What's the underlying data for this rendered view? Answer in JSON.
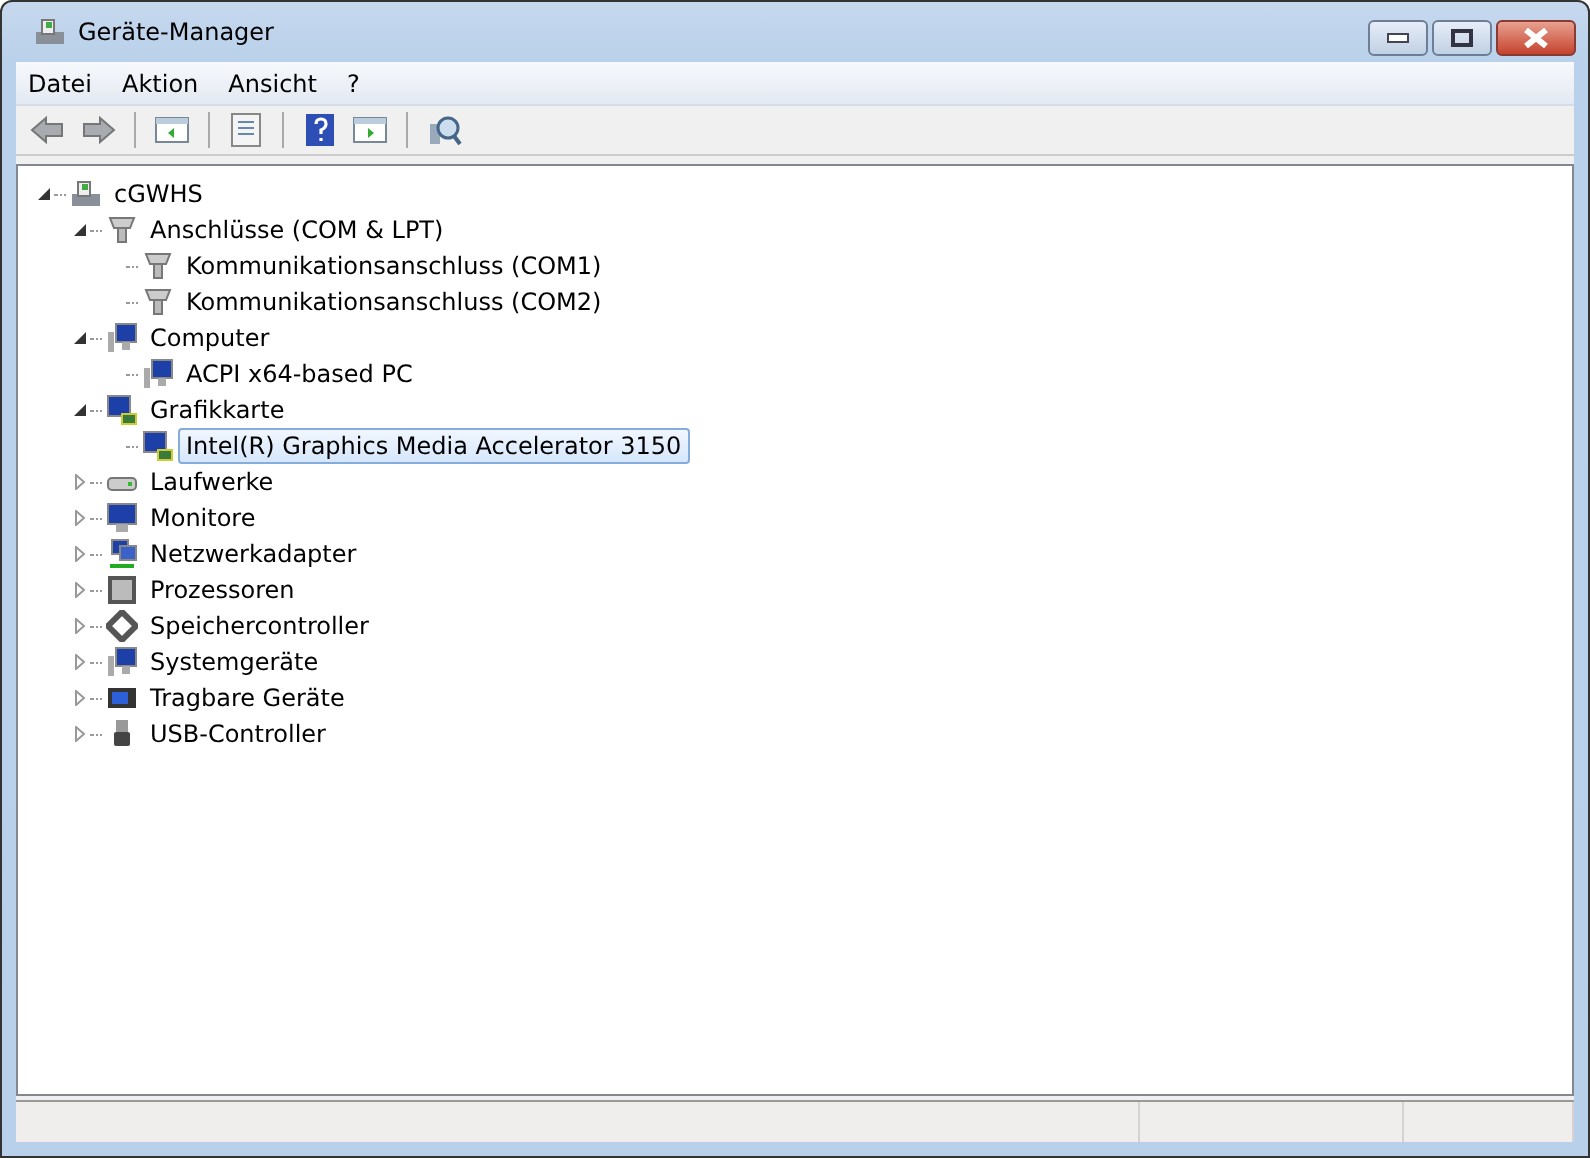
{
  "window": {
    "title": "Geräte-Manager"
  },
  "menu": [
    "Datei",
    "Aktion",
    "Ansicht",
    "?"
  ],
  "toolbar": [
    {
      "kind": "back",
      "disabled": true
    },
    {
      "kind": "forward",
      "disabled": true
    },
    {
      "kind": "sep"
    },
    {
      "kind": "pane"
    },
    {
      "kind": "sep"
    },
    {
      "kind": "props"
    },
    {
      "kind": "sep"
    },
    {
      "kind": "help"
    },
    {
      "kind": "pane2"
    },
    {
      "kind": "sep"
    },
    {
      "kind": "scan"
    }
  ],
  "tree": [
    {
      "label": "cGWHS",
      "kind": "pc",
      "expanded": true,
      "selected": false,
      "children": [
        {
          "label": "Anschlüsse (COM & LPT)",
          "kind": "port",
          "expanded": true,
          "selected": false,
          "children": [
            {
              "label": "Kommunikationsanschluss (COM1)",
              "kind": "port",
              "selected": false
            },
            {
              "label": "Kommunikationsanschluss (COM2)",
              "kind": "port",
              "selected": false
            }
          ]
        },
        {
          "label": "Computer",
          "kind": "computer",
          "expanded": true,
          "selected": false,
          "children": [
            {
              "label": "ACPI x64-based PC",
              "kind": "computer",
              "selected": false
            }
          ]
        },
        {
          "label": "Grafikkarte",
          "kind": "display",
          "expanded": true,
          "selected": false,
          "children": [
            {
              "label": "Intel(R) Graphics Media Accelerator 3150",
              "kind": "display",
              "selected": true
            }
          ]
        },
        {
          "label": "Laufwerke",
          "kind": "drive",
          "expanded": false,
          "selected": false
        },
        {
          "label": "Monitore",
          "kind": "monitor",
          "expanded": false,
          "selected": false
        },
        {
          "label": "Netzwerkadapter",
          "kind": "network",
          "expanded": false,
          "selected": false
        },
        {
          "label": "Prozessoren",
          "kind": "cpu",
          "expanded": false,
          "selected": false
        },
        {
          "label": "Speichercontroller",
          "kind": "storage",
          "expanded": false,
          "selected": false
        },
        {
          "label": "Systemgeräte",
          "kind": "computer",
          "expanded": false,
          "selected": false
        },
        {
          "label": "Tragbare Geräte",
          "kind": "portable",
          "expanded": false,
          "selected": false
        },
        {
          "label": "USB-Controller",
          "kind": "usb",
          "expanded": false,
          "selected": false
        }
      ]
    }
  ]
}
